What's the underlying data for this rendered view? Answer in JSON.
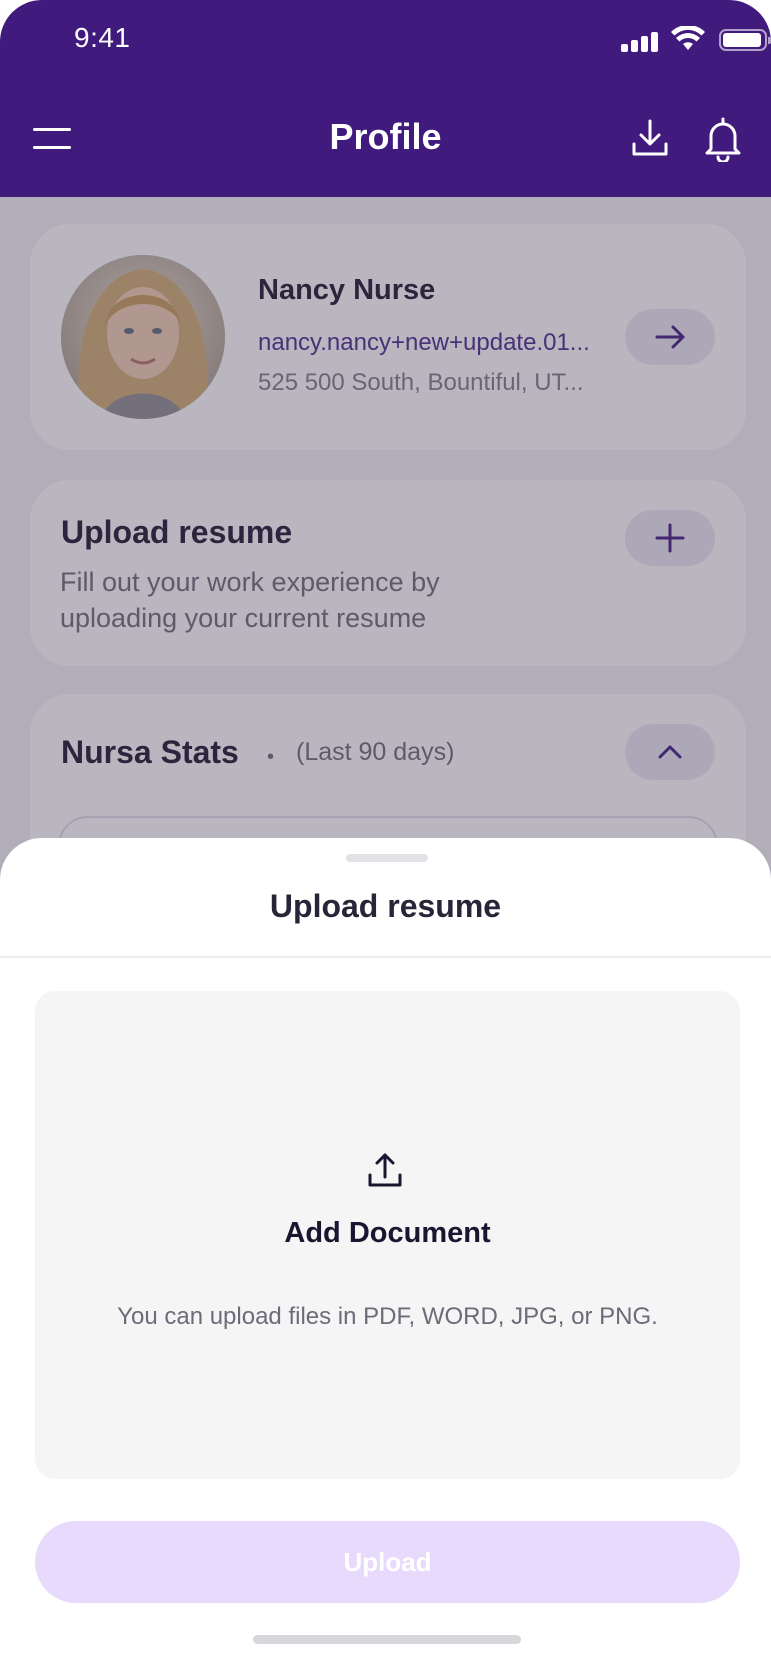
{
  "status_bar": {
    "time": "9:41"
  },
  "header": {
    "title": "Profile"
  },
  "profile": {
    "name": "Nancy Nurse",
    "email": "nancy.nancy+new+update.01...",
    "address": "525 500 South, Bountiful, UT..."
  },
  "upload_card": {
    "title": "Upload resume",
    "description": "Fill out your work experience by uploading your current resume"
  },
  "stats": {
    "title": "Nursa Stats",
    "separator": "•",
    "range": "(Last 90 days)"
  },
  "sheet": {
    "title": "Upload resume",
    "dropzone_title": "Add Document",
    "dropzone_hint": "You can upload files in PDF, WORD, JPG, or PNG.",
    "upload_label": "Upload"
  },
  "colors": {
    "brand": "#411a7e",
    "upload_button_disabled": "#e8dafc"
  },
  "icons": {
    "menu": "hamburger-icon",
    "download": "download-icon",
    "notifications": "bell-icon",
    "profile_action": "arrow-right-icon",
    "add": "plus-icon",
    "collapse": "chevron-up-icon",
    "dropzone": "upload-icon"
  }
}
